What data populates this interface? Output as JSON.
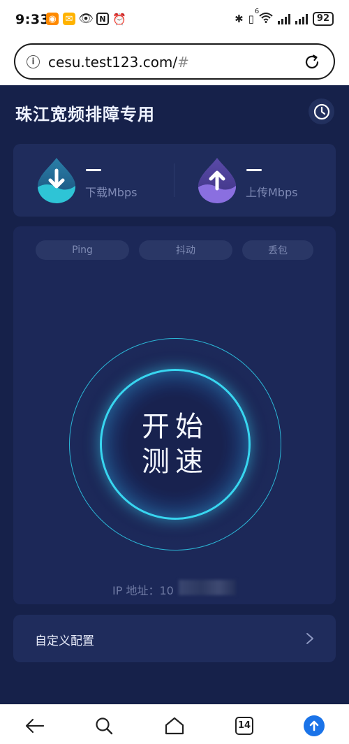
{
  "status_bar": {
    "time": "9:33",
    "battery": "92",
    "network_label": "6"
  },
  "browser": {
    "url_main": "cesu.test123.com/",
    "url_hash": "#"
  },
  "app": {
    "title": "珠江宽频排障专用",
    "download": {
      "value": "—",
      "label": "下载Mbps"
    },
    "upload": {
      "value": "—",
      "label": "上传Mbps"
    },
    "metrics": [
      {
        "label": "Ping"
      },
      {
        "label": "抖动"
      },
      {
        "label": "丢包"
      }
    ],
    "start_button": {
      "line1": "开始",
      "line2": "测速"
    },
    "ip_label": "IP 地址：10",
    "config_label": "自定义配置",
    "colors": {
      "background": "#16214a",
      "card": "#1f2c5c",
      "accent_cyan": "#38d6f0",
      "download_teal": "#2ec4d6",
      "upload_purple": "#8a6fe0"
    }
  },
  "bottom_nav": {
    "tab_count": "14",
    "icons": [
      "back-arrow-icon",
      "search-icon",
      "home-icon",
      "tabs-icon",
      "upload-circle-icon"
    ]
  }
}
